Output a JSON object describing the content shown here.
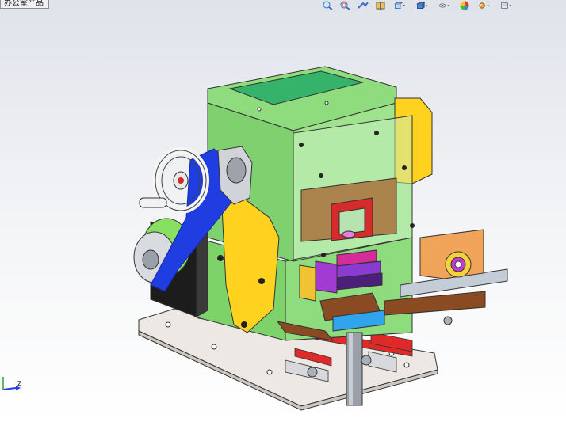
{
  "tab": {
    "label": "办公室产品"
  },
  "toolbar": {
    "items": [
      {
        "icon": "zoom-to-fit-icon",
        "has_dropdown": false
      },
      {
        "icon": "zoom-to-area-icon",
        "has_dropdown": false
      },
      {
        "icon": "previous-view-icon",
        "has_dropdown": false
      },
      {
        "icon": "section-view-icon",
        "has_dropdown": false
      },
      {
        "icon": "view-orientation-icon",
        "has_dropdown": true
      },
      {
        "icon": "display-style-icon",
        "has_dropdown": true
      },
      {
        "icon": "hide-show-items-icon",
        "has_dropdown": true
      },
      {
        "icon": "edit-appearance-icon",
        "has_dropdown": false
      },
      {
        "icon": "apply-scene-icon",
        "has_dropdown": true
      },
      {
        "icon": "view-settings-icon",
        "has_dropdown": true
      }
    ]
  },
  "triad": {
    "axis_label": "Z"
  },
  "colors": {
    "housing": "#8fdc7e",
    "cover_plate": "#36b36a",
    "belt": "#1f3de0",
    "base_plate": "#ece7e2",
    "guard_yellow": "#ffd21f",
    "orange_bracket": "#f0a45a",
    "brown_block": "#8a4a22",
    "blue_block": "#31a4ee",
    "red_spacer": "#e32b2b",
    "purple_part": "#a23bd1",
    "magenta_part": "#d42c98"
  }
}
